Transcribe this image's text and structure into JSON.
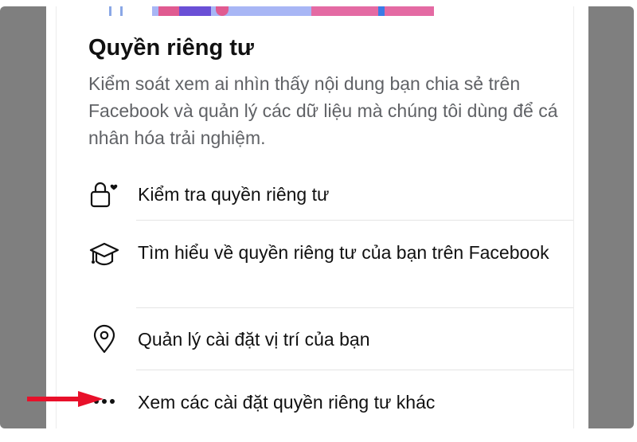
{
  "section": {
    "title": "Quyền riêng tư",
    "description": "Kiểm soát xem ai nhìn thấy nội dung bạn chia sẻ trên Facebook và quản lý các dữ liệu mà chúng tôi dùng để cá nhân hóa trải nghiệm."
  },
  "items": [
    {
      "icon": "lock-heart-icon",
      "label": "Kiểm tra quyền riêng tư"
    },
    {
      "icon": "graduation-cap-icon",
      "label": "Tìm hiểu về quyền riêng tư của bạn trên Facebook"
    },
    {
      "icon": "location-pin-icon",
      "label": "Quản lý cài đặt vị trí của bạn"
    },
    {
      "icon": "more-dots-icon",
      "label": "Xem các cài đặt quyền riêng tư khác"
    }
  ],
  "colors": {
    "background_frame": "#7f7f7f",
    "title": "#111111",
    "description": "#606266",
    "divider": "#e4e4e4",
    "arrow": "#e8102a"
  }
}
